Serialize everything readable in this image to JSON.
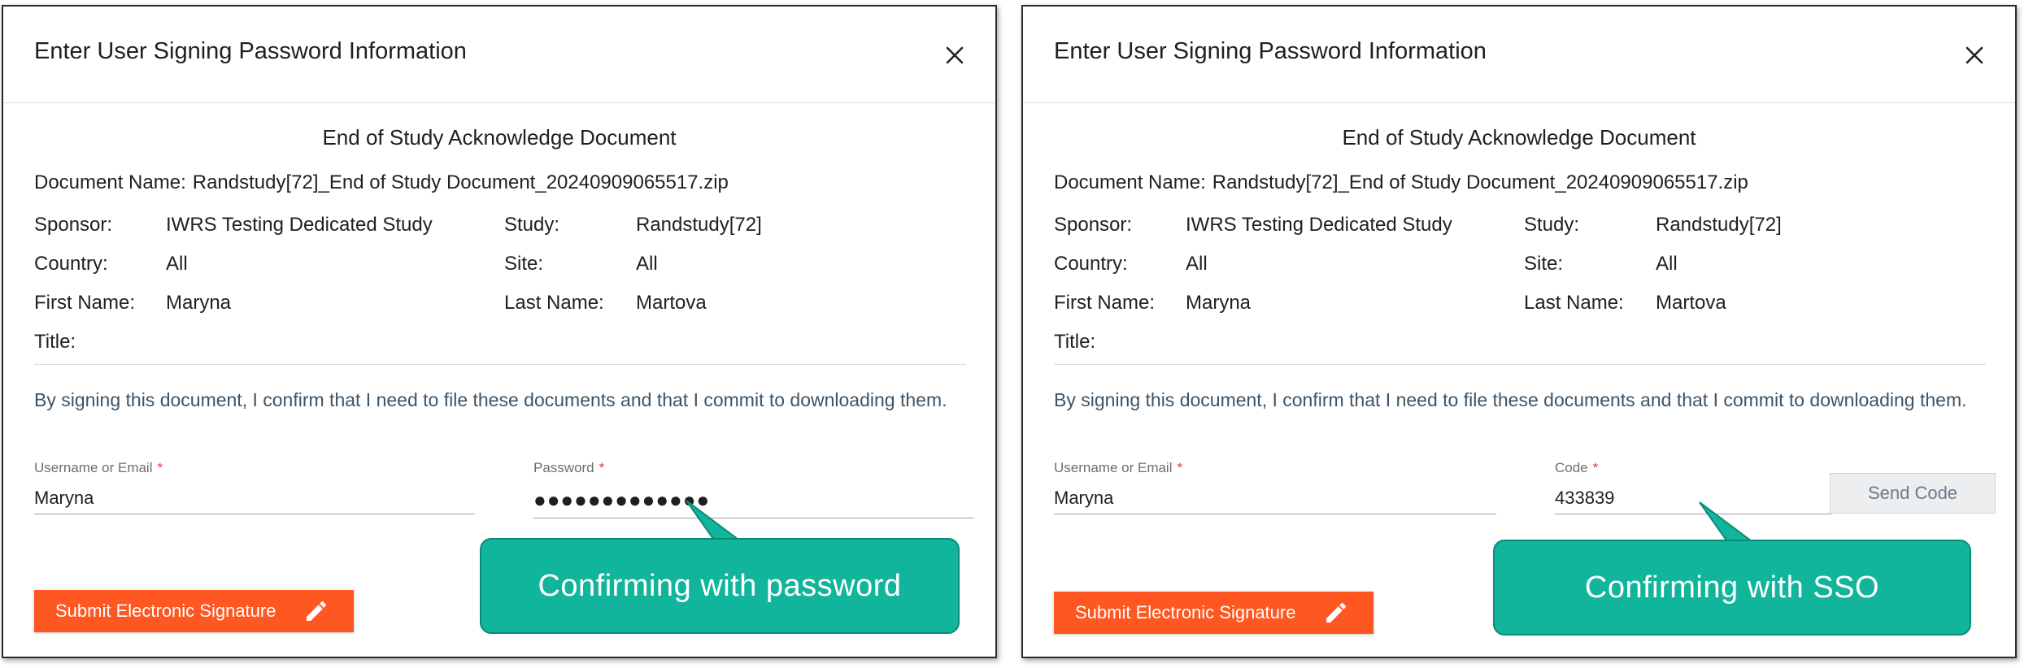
{
  "dialogs": [
    {
      "title": "Enter User Signing Password Information",
      "doc_title": "End of Study Acknowledge Document",
      "doc_name_label": "Document Name:",
      "doc_name_value": "Randstudy[72]_End of Study Document_20240909065517.zip",
      "sponsor_label": "Sponsor:",
      "sponsor_value": "IWRS Testing Dedicated Study",
      "study_label": "Study:",
      "study_value": "Randstudy[72]",
      "country_label": "Country:",
      "country_value": "All",
      "site_label": "Site:",
      "site_value": "All",
      "first_name_label": "First Name:",
      "first_name_value": "Maryna",
      "last_name_label": "Last Name:",
      "last_name_value": "Martova",
      "title_label": "Title:",
      "title_value": "",
      "confirm_text": "By signing this document, I confirm that I need to file these documents and that I commit to downloading them.",
      "username_label": "Username or Email",
      "username_value": "Maryna",
      "secret_label": "Password",
      "secret_value": "●●●●●●●●●●●●●",
      "submit_label": "Submit Electronic Signature",
      "callout_text": "Confirming with password"
    },
    {
      "title": "Enter User Signing Password Information",
      "doc_title": "End of Study Acknowledge Document",
      "doc_name_label": "Document Name:",
      "doc_name_value": "Randstudy[72]_End of Study Document_20240909065517.zip",
      "sponsor_label": "Sponsor:",
      "sponsor_value": "IWRS Testing Dedicated Study",
      "study_label": "Study:",
      "study_value": "Randstudy[72]",
      "country_label": "Country:",
      "country_value": "All",
      "site_label": "Site:",
      "site_value": "All",
      "first_name_label": "First Name:",
      "first_name_value": "Maryna",
      "last_name_label": "Last Name:",
      "last_name_value": "Martova",
      "title_label": "Title:",
      "title_value": "",
      "confirm_text": "By signing this document, I confirm that I need to file these documents and that I commit to downloading them.",
      "username_label": "Username or Email",
      "username_value": "Maryna",
      "secret_label": "Code",
      "secret_value": "433839",
      "send_code_label": "Send Code",
      "submit_label": "Submit Electronic Signature",
      "callout_text": "Confirming with SSO"
    }
  ],
  "colors": {
    "submit_button": "#ff5722",
    "callout": "#11b59c",
    "required_star": "#e53935",
    "confirm_text": "#3d5466"
  },
  "icons": {
    "close": "close-icon",
    "edit": "pencil-icon"
  }
}
